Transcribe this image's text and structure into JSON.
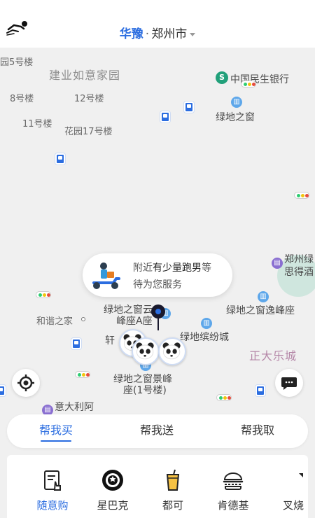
{
  "header": {
    "area": "华豫",
    "separator": "·",
    "city": "郑州市"
  },
  "map": {
    "labels": {
      "bldg5": "园5号楼",
      "community": "建业如意家园",
      "bldg8": "8号楼",
      "bldg12": "12号楼",
      "bldg11": "11号楼",
      "garden17": "花园17号楼",
      "bank": "中国民生银行",
      "lvdi_window": "绿地之窗",
      "zhengzhou_lv": "郑州绿",
      "siide": "思得酒",
      "lvdi_yifeng": "绿地之窗逸峰座",
      "hexie": "和谐之家",
      "lvdi_yunfeng_1": "绿地之窗云",
      "lvdi_yunfeng_2": "峰座A座",
      "xuan": "轩",
      "lvdi_bingfen": "绿地缤纷城",
      "zhengda": "正大乐城",
      "jingfeng_1": "绿地之窗景峰",
      "jingfeng_2": "座(1号楼)",
      "italy": "意大利阿"
    },
    "bubble": {
      "prefix": "附近",
      "highlight": "有少量跑男",
      "suffix": "等",
      "line2": "待为您服务"
    }
  },
  "tabs": [
    {
      "label": "帮我买",
      "active": true
    },
    {
      "label": "帮我送",
      "active": false
    },
    {
      "label": "帮我取",
      "active": false
    }
  ],
  "shops": [
    {
      "name": "随意购",
      "icon": "shopping-list-icon",
      "active": true
    },
    {
      "name": "星巴克",
      "icon": "starbucks-icon",
      "active": false
    },
    {
      "name": "都可",
      "icon": "drink-cup-icon",
      "active": false
    },
    {
      "name": "肯德基",
      "icon": "burger-icon",
      "active": false
    },
    {
      "name": "叉烧",
      "icon": "more-icon",
      "active": false
    }
  ],
  "colors": {
    "accent": "#2b6de0",
    "bank_green": "#21a07a",
    "poi_blue": "#5ea7ea"
  }
}
